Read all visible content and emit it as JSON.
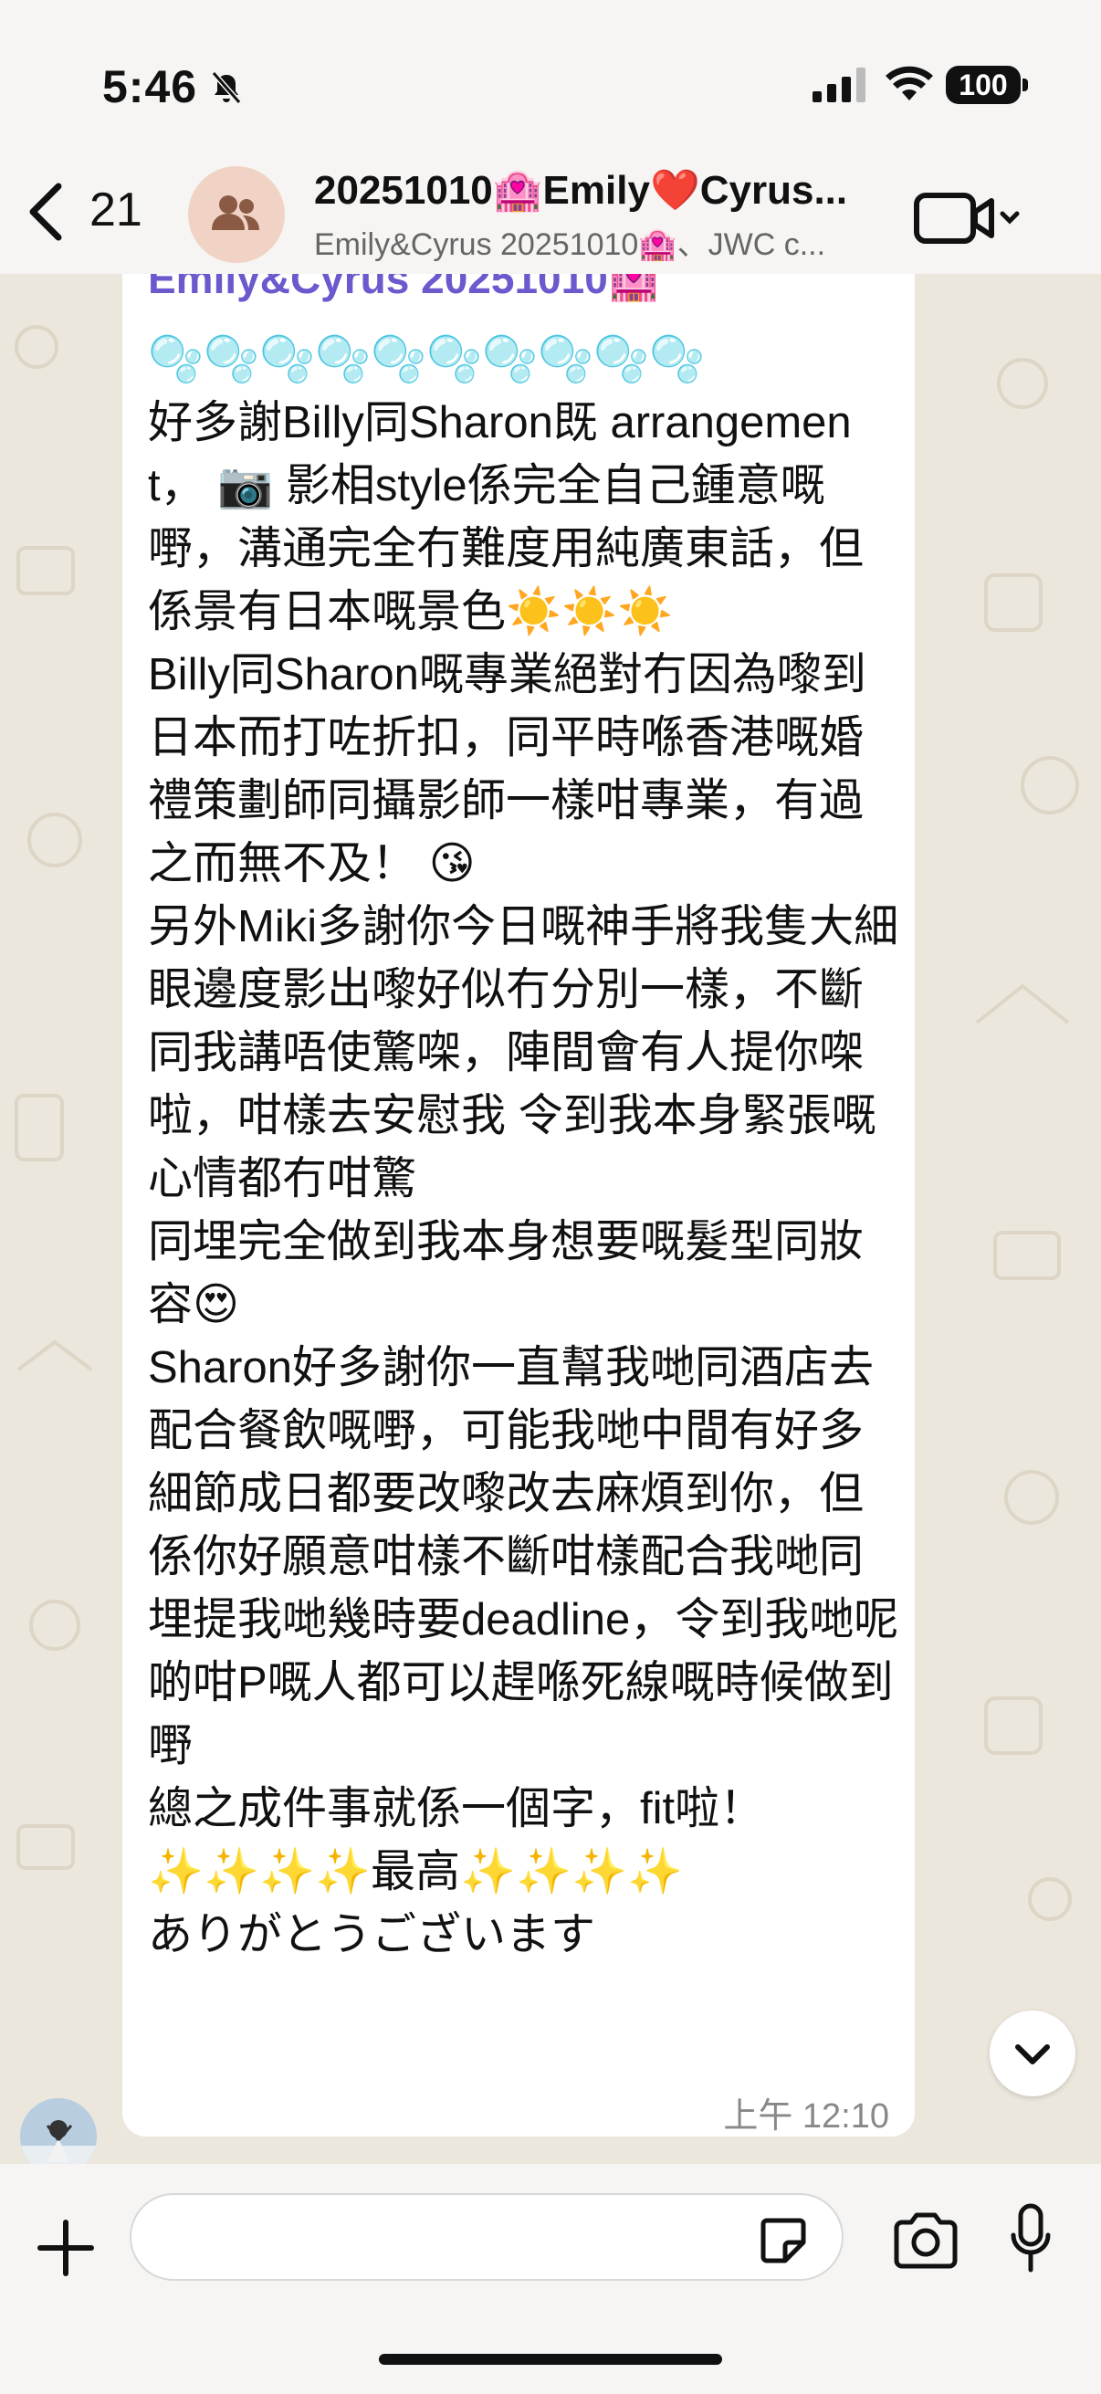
{
  "status_bar": {
    "time": "5:46",
    "battery": "100",
    "icons": [
      "bell-slash-icon",
      "cellular-signal-icon",
      "wifi-icon",
      "battery-icon"
    ]
  },
  "header": {
    "unread_count": "21",
    "title": "20251010🏩Emily❤️Cyrus...",
    "subtitle": "Emily&Cyrus 20251010🏩、JWC c...",
    "icons": [
      "chevron-left-icon",
      "group-icon",
      "video-call-icon",
      "chevron-down-icon"
    ]
  },
  "message": {
    "sender": "Emily&Cyrus 20251010🏩",
    "text": "🫧🫧🫧🫧🫧🫧🫧🫧🫧🫧\n好多謝Billy同Sharon既 arrangement， 📷 影相style係完全自己鍾意嘅嘢，溝通完全冇難度用純廣東話，但係景有日本嘅景色☀️☀️☀️\nBilly同Sharon嘅專業絕對冇因為嚟到日本而打咗折扣，同平時喺香港嘅婚禮策劃師同攝影師一樣咁專業，有過之而無不及！ 😘\n另外Miki多謝你今日嘅神手將我隻大細眼邊度影出嚟好似冇分別一樣，不斷同我講唔使驚㗎，陣間會有人提你㗎啦，咁樣去安慰我 令到我本身緊張嘅心情都冇咁驚\n同埋完全做到我本身想要嘅髮型同妝容😍\nSharon好多謝你一直幫我哋同酒店去配合餐飲嘅嘢，可能我哋中間有好多細節成日都要改嚟改去麻煩到你，但係你好願意咁樣不斷咁樣配合我哋同埋提我哋幾時要deadline，令到我哋呢啲咁P嘅人都可以趕喺死線嘅時候做到嘢\n總之成件事就係一個字，fit啦！\n✨✨✨✨最高✨✨✨✨\nありがとうございます",
    "time": "上午 12:10"
  },
  "input": {
    "placeholder": "",
    "icons": [
      "plus-icon",
      "sticker-icon",
      "camera-icon",
      "microphone-icon"
    ]
  },
  "colors": {
    "sender_name": "#6a5acd",
    "chat_background": "#ece7dc",
    "bubble": "#ffffff"
  }
}
